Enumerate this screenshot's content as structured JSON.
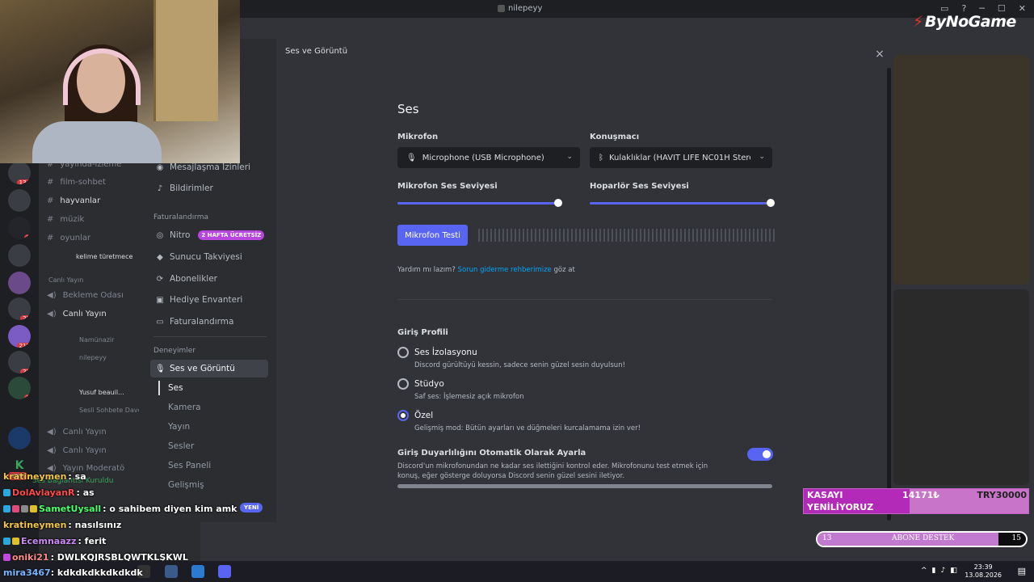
{
  "window": {
    "title": "nilepeyy"
  },
  "logo": {
    "text": "ByNoGame"
  },
  "modal": {
    "header_title": "Ses ve Görüntü",
    "close_label": "×"
  },
  "sidebar": {
    "items_top": [
      {
        "label": "Mesajlaşma İzinleri",
        "icon": "chat-bubble-icon"
      },
      {
        "label": "Bildirimler",
        "icon": "bell-icon"
      }
    ],
    "billing_category": "Faturalandırma",
    "billing_items": [
      {
        "label": "Nitro",
        "icon": "nitro-icon",
        "badge": "2 HAFTA ÜCRETSİZ"
      },
      {
        "label": "Sunucu Takviyesi",
        "icon": "boost-icon"
      },
      {
        "label": "Abonelikler",
        "icon": "subscription-icon"
      },
      {
        "label": "Hediye Envanteri",
        "icon": "gift-icon"
      },
      {
        "label": "Faturalandırma",
        "icon": "card-icon"
      }
    ],
    "experience_category": "Deneyimler",
    "active_item": "Ses ve Görüntü",
    "sub_items": [
      "Ses",
      "Kamera",
      "Yayın",
      "Sesler",
      "Ses Paneli",
      "Gelişmiş"
    ],
    "new_badge": "YENİ"
  },
  "voice": {
    "section_title": "Ses",
    "mic_label": "Mikrofon",
    "mic_value": "Microphone (USB Microphone)",
    "speaker_label": "Konuşmacı",
    "speaker_value": "Kulaklıklar (HAVIT LIFE NC01H Stereo",
    "mic_volume_label": "Mikrofon Ses Seviyesi",
    "speaker_volume_label": "Hoparlör Ses Seviyesi",
    "mic_volume": 0.89,
    "speaker_volume": 1.0,
    "mic_test_button": "Mikrofon Testi",
    "help_prefix": "Yardım mı lazım?",
    "help_link": "Sorun giderme rehberimize",
    "help_suffix": "göz at"
  },
  "input_profile": {
    "title": "Giriş Profili",
    "options": [
      {
        "title": "Ses İzolasyonu",
        "desc": "Discord gürültüyü kessin, sadece senin güzel sesin duyulsun!",
        "selected": false
      },
      {
        "title": "Stüdyo",
        "desc": "Saf ses: İşlemesiz açık mikrofon",
        "selected": false
      },
      {
        "title": "Özel",
        "desc": "Gelişmiş mod: Bütün ayarları ve düğmeleri kurcalamama izin ver!",
        "selected": true
      }
    ],
    "auto_sensitivity_title": "Giriş Duyarlılığını Otomatik Olarak Ayarla",
    "auto_sensitivity_desc_1": "Discord'un mikrofonundan ne kadar ses ilettiğini kontrol eder. Mikrofonunu test etmek için",
    "auto_sensitivity_desc_2": "konuş, eğer gösterge doluyorsa Discord senin güzel sesini iletiyor.",
    "auto_sensitivity_on": true
  },
  "background_channels": [
    {
      "name": "yayında-izleme"
    },
    {
      "name": "film-sohbet"
    },
    {
      "name": "hayvanlar"
    },
    {
      "name": "müzik"
    },
    {
      "name": "oyunlar"
    },
    {
      "name": "kelime türetmece"
    },
    {
      "name": "Canlı Yayın"
    },
    {
      "name": "Bekleme Odası"
    },
    {
      "name": "Canlı Yayın"
    },
    {
      "name": "Namünazir"
    },
    {
      "name": "nilepeyy"
    },
    {
      "name": "Yusuf beauil..."
    },
    {
      "name": "Sesli Sohbete Davet Et"
    },
    {
      "name": "Canlı Yayın"
    },
    {
      "name": "Canlı Yayın"
    },
    {
      "name": "Yayın Moderatö"
    },
    {
      "name": "Ses Bağlantısı Kuruldu"
    }
  ],
  "server_badges": [
    "134",
    "8",
    "29",
    "212",
    "29",
    "8"
  ],
  "server_new": "YENİ",
  "stream_chat": [
    {
      "user": "kratineymen",
      "msg": ": sa",
      "color": "#f4c74a"
    },
    {
      "user": "DolAvlayanR",
      "msg": ": as",
      "color": "#ff4a4a"
    },
    {
      "user": "SametUysall",
      "msg": ": o sahibem diyen kim amk",
      "color": "#4aff6a"
    },
    {
      "user": "kratineymen",
      "msg": ": nasılsınız",
      "color": "#f4c74a"
    },
    {
      "user": "Ecemnaazz",
      "msg": ": ferit",
      "color": "#c98af4"
    },
    {
      "user": "oniki21",
      "msg": ": DWLKQJRŞBLQWTKLŞKWL",
      "color": "#ff8a8a"
    },
    {
      "user": "mira3467",
      "msg": ": kdkdkdkkdkdkdk",
      "color": "#7ab4ff"
    }
  ],
  "kasa": {
    "title_1": "KASAYI",
    "title_2": "YENİLİYORUZ",
    "current": "14171₺",
    "goal": "TRY30000",
    "progress": 0.47
  },
  "abone": {
    "label": "ABONE DESTEK",
    "current": "13",
    "goal": "15",
    "progress": 0.87
  },
  "clock": {
    "time": "23:39",
    "date": "13.08.2026"
  },
  "colors": {
    "accent": "#5865f2",
    "link": "#00a8fc",
    "nitro": "#b845e0"
  }
}
